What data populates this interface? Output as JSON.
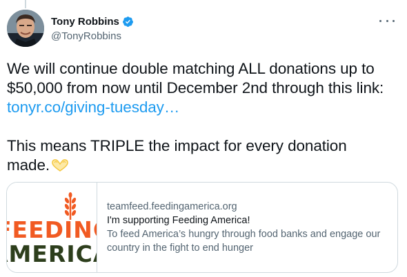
{
  "tweet": {
    "author": {
      "display_name": "Tony Robbins",
      "handle": "@TonyRobbins",
      "verified": true,
      "avatar_icon": "avatar-photo"
    },
    "more_icon": "more-horizontal-icon",
    "text": {
      "line1_pre": "We will continue double matching ALL donations up to $50,000 from now until December 2nd through this link: ",
      "link": "tonyr.co/giving-tuesday…",
      "line2": "This means TRIPLE the impact for every donation made.",
      "emoji": "heart-hands-emoji"
    },
    "card": {
      "image_text_line1": "FEEDING",
      "image_text_line2": "AMERICA",
      "domain": "teamfeed.feedingamerica.org",
      "title": "I'm supporting Feeding America!",
      "description": "To feed America’s hungry through food banks and engage our country in the fight to end hunger"
    }
  },
  "colors": {
    "link": "#1d9bf0",
    "verified": "#1d9bf0",
    "secondary_text": "#536471",
    "border": "#cfd9de",
    "logo_orange": "#f15a22",
    "logo_dark": "#2d3e1c"
  }
}
